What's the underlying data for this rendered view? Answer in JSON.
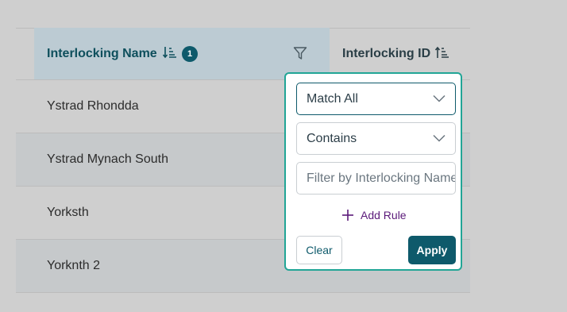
{
  "table": {
    "columns": {
      "name": {
        "label": "Interlocking Name",
        "sort_order_badge": "1"
      },
      "id": {
        "label": "Interlocking ID"
      }
    },
    "rows": [
      {
        "name": "Ystrad Rhondda"
      },
      {
        "name": "Ystrad Mynach South"
      },
      {
        "name": "Yorksth"
      },
      {
        "name": "Yorknth 2"
      }
    ]
  },
  "filter_popup": {
    "operator_select": "Match All",
    "match_mode_select": "Contains",
    "value_input": {
      "value": "",
      "placeholder": "Filter by Interlocking Name"
    },
    "add_rule_label": "Add Rule",
    "clear_label": "Clear",
    "apply_label": "Apply"
  },
  "colors": {
    "accent": "#0e5a6b",
    "popup_border": "#21a596",
    "header_highlight": "#bccbd3",
    "add_rule": "#5b1a7a"
  }
}
